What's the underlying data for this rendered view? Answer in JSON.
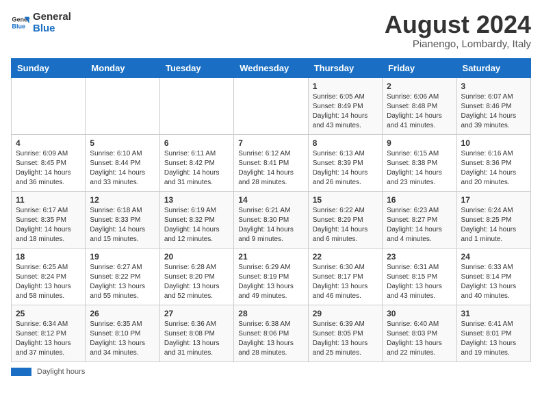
{
  "logo": {
    "line1": "General",
    "line2": "Blue"
  },
  "title": "August 2024",
  "location": "Pianengo, Lombardy, Italy",
  "days_header": [
    "Sunday",
    "Monday",
    "Tuesday",
    "Wednesday",
    "Thursday",
    "Friday",
    "Saturday"
  ],
  "weeks": [
    [
      {
        "day": "",
        "info": ""
      },
      {
        "day": "",
        "info": ""
      },
      {
        "day": "",
        "info": ""
      },
      {
        "day": "",
        "info": ""
      },
      {
        "day": "1",
        "info": "Sunrise: 6:05 AM\nSunset: 8:49 PM\nDaylight: 14 hours and 43 minutes."
      },
      {
        "day": "2",
        "info": "Sunrise: 6:06 AM\nSunset: 8:48 PM\nDaylight: 14 hours and 41 minutes."
      },
      {
        "day": "3",
        "info": "Sunrise: 6:07 AM\nSunset: 8:46 PM\nDaylight: 14 hours and 39 minutes."
      }
    ],
    [
      {
        "day": "4",
        "info": "Sunrise: 6:09 AM\nSunset: 8:45 PM\nDaylight: 14 hours and 36 minutes."
      },
      {
        "day": "5",
        "info": "Sunrise: 6:10 AM\nSunset: 8:44 PM\nDaylight: 14 hours and 33 minutes."
      },
      {
        "day": "6",
        "info": "Sunrise: 6:11 AM\nSunset: 8:42 PM\nDaylight: 14 hours and 31 minutes."
      },
      {
        "day": "7",
        "info": "Sunrise: 6:12 AM\nSunset: 8:41 PM\nDaylight: 14 hours and 28 minutes."
      },
      {
        "day": "8",
        "info": "Sunrise: 6:13 AM\nSunset: 8:39 PM\nDaylight: 14 hours and 26 minutes."
      },
      {
        "day": "9",
        "info": "Sunrise: 6:15 AM\nSunset: 8:38 PM\nDaylight: 14 hours and 23 minutes."
      },
      {
        "day": "10",
        "info": "Sunrise: 6:16 AM\nSunset: 8:36 PM\nDaylight: 14 hours and 20 minutes."
      }
    ],
    [
      {
        "day": "11",
        "info": "Sunrise: 6:17 AM\nSunset: 8:35 PM\nDaylight: 14 hours and 18 minutes."
      },
      {
        "day": "12",
        "info": "Sunrise: 6:18 AM\nSunset: 8:33 PM\nDaylight: 14 hours and 15 minutes."
      },
      {
        "day": "13",
        "info": "Sunrise: 6:19 AM\nSunset: 8:32 PM\nDaylight: 14 hours and 12 minutes."
      },
      {
        "day": "14",
        "info": "Sunrise: 6:21 AM\nSunset: 8:30 PM\nDaylight: 14 hours and 9 minutes."
      },
      {
        "day": "15",
        "info": "Sunrise: 6:22 AM\nSunset: 8:29 PM\nDaylight: 14 hours and 6 minutes."
      },
      {
        "day": "16",
        "info": "Sunrise: 6:23 AM\nSunset: 8:27 PM\nDaylight: 14 hours and 4 minutes."
      },
      {
        "day": "17",
        "info": "Sunrise: 6:24 AM\nSunset: 8:25 PM\nDaylight: 14 hours and 1 minute."
      }
    ],
    [
      {
        "day": "18",
        "info": "Sunrise: 6:25 AM\nSunset: 8:24 PM\nDaylight: 13 hours and 58 minutes."
      },
      {
        "day": "19",
        "info": "Sunrise: 6:27 AM\nSunset: 8:22 PM\nDaylight: 13 hours and 55 minutes."
      },
      {
        "day": "20",
        "info": "Sunrise: 6:28 AM\nSunset: 8:20 PM\nDaylight: 13 hours and 52 minutes."
      },
      {
        "day": "21",
        "info": "Sunrise: 6:29 AM\nSunset: 8:19 PM\nDaylight: 13 hours and 49 minutes."
      },
      {
        "day": "22",
        "info": "Sunrise: 6:30 AM\nSunset: 8:17 PM\nDaylight: 13 hours and 46 minutes."
      },
      {
        "day": "23",
        "info": "Sunrise: 6:31 AM\nSunset: 8:15 PM\nDaylight: 13 hours and 43 minutes."
      },
      {
        "day": "24",
        "info": "Sunrise: 6:33 AM\nSunset: 8:14 PM\nDaylight: 13 hours and 40 minutes."
      }
    ],
    [
      {
        "day": "25",
        "info": "Sunrise: 6:34 AM\nSunset: 8:12 PM\nDaylight: 13 hours and 37 minutes."
      },
      {
        "day": "26",
        "info": "Sunrise: 6:35 AM\nSunset: 8:10 PM\nDaylight: 13 hours and 34 minutes."
      },
      {
        "day": "27",
        "info": "Sunrise: 6:36 AM\nSunset: 8:08 PM\nDaylight: 13 hours and 31 minutes."
      },
      {
        "day": "28",
        "info": "Sunrise: 6:38 AM\nSunset: 8:06 PM\nDaylight: 13 hours and 28 minutes."
      },
      {
        "day": "29",
        "info": "Sunrise: 6:39 AM\nSunset: 8:05 PM\nDaylight: 13 hours and 25 minutes."
      },
      {
        "day": "30",
        "info": "Sunrise: 6:40 AM\nSunset: 8:03 PM\nDaylight: 13 hours and 22 minutes."
      },
      {
        "day": "31",
        "info": "Sunrise: 6:41 AM\nSunset: 8:01 PM\nDaylight: 13 hours and 19 minutes."
      }
    ]
  ],
  "legend": {
    "label": "Daylight hours"
  },
  "accent_color": "#1a6fc4"
}
